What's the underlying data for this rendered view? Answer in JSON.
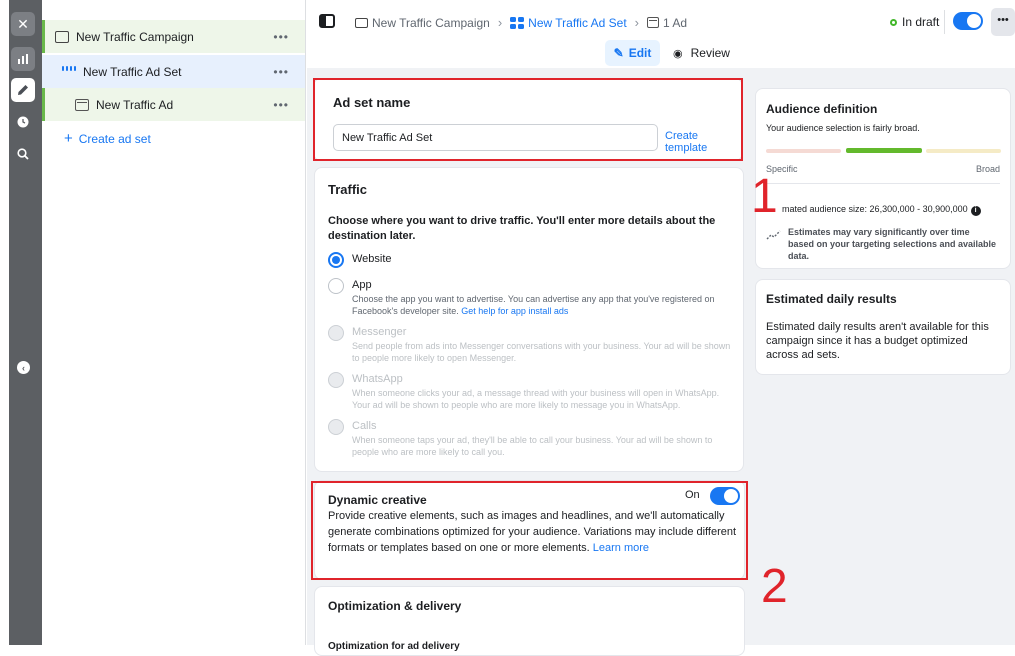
{
  "rail": {
    "icons": [
      "close-icon",
      "chart-icon",
      "pencil-icon",
      "clock-icon",
      "search-icon",
      "chevron-left-icon"
    ]
  },
  "tree": {
    "campaign": "New Traffic Campaign",
    "adset": "New Traffic Ad Set",
    "ad": "New Traffic Ad",
    "more": "•••",
    "create_ad_set": "Create ad set"
  },
  "breadcrumb": {
    "campaign": "New Traffic Campaign",
    "adset": "New Traffic Ad Set",
    "ad": "1 Ad"
  },
  "status": "In draft",
  "tabs": {
    "edit": "Edit",
    "review": "Review"
  },
  "ad_set_name": {
    "title": "Ad set name",
    "value": "New Traffic Ad Set",
    "create_template": "Create template"
  },
  "traffic": {
    "title": "Traffic",
    "intro": "Choose where you want to drive traffic. You'll enter more details about the destination later.",
    "options": [
      {
        "label": "Website",
        "desc": "",
        "selected": true,
        "disabled": false
      },
      {
        "label": "App",
        "desc": "Choose the app you want to advertise. You can advertise any app that you've registered on Facebook's developer site.",
        "link": "Get help for app install ads",
        "selected": false,
        "disabled": false
      },
      {
        "label": "Messenger",
        "desc": "Send people from ads into Messenger conversations with your business. Your ad will be shown to people more likely to open Messenger.",
        "selected": false,
        "disabled": true
      },
      {
        "label": "WhatsApp",
        "desc": "When someone clicks your ad, a message thread with your business will open in WhatsApp. Your ad will be shown to people who are more likely to message you in WhatsApp.",
        "selected": false,
        "disabled": true
      },
      {
        "label": "Calls",
        "desc": "When someone taps your ad, they'll be able to call your business. Your ad will be shown to people who are more likely to call you.",
        "selected": false,
        "disabled": true
      }
    ]
  },
  "dynamic_creative": {
    "title": "Dynamic creative",
    "state": "On",
    "body": "Provide creative elements, such as images and headlines, and we'll automatically generate combinations optimized for your audience. Variations may include different formats or templates based on one or more elements.",
    "link": "Learn more"
  },
  "optimization": {
    "title": "Optimization & delivery",
    "subtitle": "Optimization for ad delivery"
  },
  "audience": {
    "title": "Audience definition",
    "subtitle": "Your audience selection is fairly broad.",
    "specific": "Specific",
    "broad": "Broad",
    "size": "mated audience size: 26,300,000 - 30,900,000",
    "note": "Estimates may vary significantly over time based on your targeting selections and available data."
  },
  "daily": {
    "title": "Estimated daily results",
    "body": "Estimated daily results aren't available for this campaign since it has a budget optimized across ad sets."
  },
  "annotations": {
    "one": "1",
    "two": "2"
  },
  "colors": {
    "accent": "#1877f2",
    "annotation": "#e0242b",
    "meter_active": "#63b92c",
    "draft": "#42b72a"
  }
}
